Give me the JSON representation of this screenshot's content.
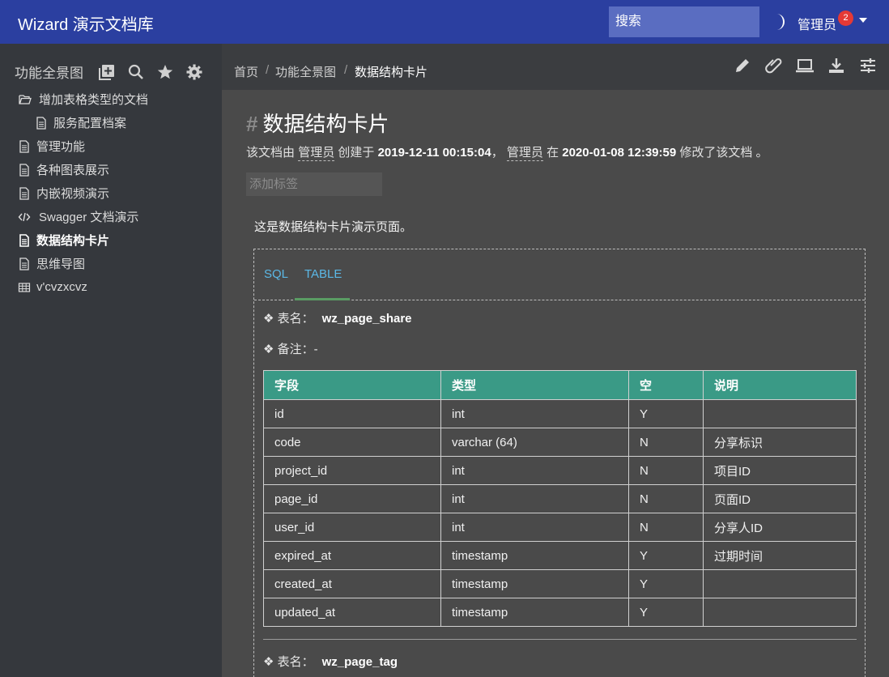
{
  "app": {
    "title": "Wizard 演示文档库"
  },
  "topbar": {
    "search_placeholder": "搜索",
    "user": "管理员",
    "notifications": "2"
  },
  "sidebar": {
    "heading": "功能全景图",
    "items": [
      {
        "label": "增加表格类型的文档",
        "icon": "folder-open-icon"
      },
      {
        "label": "服务配置档案",
        "icon": "document-icon"
      },
      {
        "label": "管理功能",
        "icon": "document-icon"
      },
      {
        "label": "各种图表展示",
        "icon": "document-icon"
      },
      {
        "label": "内嵌视频演示",
        "icon": "document-icon"
      },
      {
        "label": "Swagger 文档演示",
        "icon": "code-icon"
      },
      {
        "label": "数据结构卡片",
        "icon": "document-icon"
      },
      {
        "label": "思维导图",
        "icon": "document-icon"
      },
      {
        "label": "v'cvzxcvz",
        "icon": "table-icon"
      }
    ]
  },
  "breadcrumb": {
    "items": [
      "首页",
      "功能全景图",
      "数据结构卡片"
    ],
    "separator": "/"
  },
  "doc": {
    "title": "数据结构卡片",
    "meta": {
      "prefix": "该文档由",
      "creator": "管理员",
      "created_label": "创建于",
      "created_at": "2019-12-11 00:15:04",
      "sep": "，",
      "editor": "管理员",
      "edited_label": "在",
      "edited_at": "2020-01-08 12:39:59",
      "suffix": "修改了该文档 。"
    },
    "tag_placeholder": "添加标签",
    "intro": "这是数据结构卡片演示页面。"
  },
  "card": {
    "tabs": [
      "SQL",
      "TABLE"
    ],
    "active_tab": "TABLE",
    "table_name_label": "❖ 表名：",
    "table_name": "wz_page_share",
    "remark_label": "❖ 备注：",
    "remark": "-",
    "columns": [
      "字段",
      "类型",
      "空",
      "说明"
    ],
    "rows": [
      [
        "id",
        "int",
        "Y",
        ""
      ],
      [
        "code",
        "varchar (64)",
        "N",
        "分享标识"
      ],
      [
        "project_id",
        "int",
        "N",
        "项目ID"
      ],
      [
        "page_id",
        "int",
        "N",
        "页面ID"
      ],
      [
        "user_id",
        "int",
        "N",
        "分享人ID"
      ],
      [
        "expired_at",
        "timestamp",
        "Y",
        "过期时间"
      ],
      [
        "created_at",
        "timestamp",
        "Y",
        ""
      ],
      [
        "updated_at",
        "timestamp",
        "Y",
        ""
      ]
    ],
    "next_table_label": "❖ 表名：",
    "next_table_name": "wz_page_tag"
  },
  "colors": {
    "topbar": "#2b3fa0",
    "accent_header": "#3a9a86",
    "tab": "#5bb8e6",
    "badge": "#e53935"
  }
}
